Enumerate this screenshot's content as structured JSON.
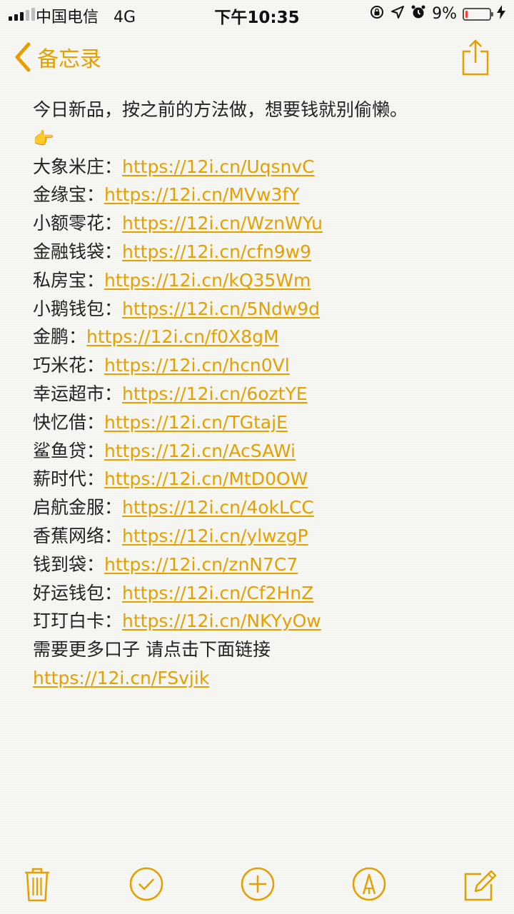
{
  "status_bar": {
    "carrier": "中国电信",
    "network": "4G",
    "time": "下午10:35",
    "battery": "9%",
    "battery_level": 0.09
  },
  "nav": {
    "back_label": "备忘录"
  },
  "note": {
    "intro": "今日新品，按之前的方法做，想要钱就别偷懒。",
    "pointer": "👉",
    "items": [
      {
        "name": "大象米庄：",
        "url": "https://12i.cn/UqsnvC"
      },
      {
        "name": "金缘宝：",
        "url": "https://12i.cn/MVw3fY"
      },
      {
        "name": "小额零花：",
        "url": "https://12i.cn/WznWYu"
      },
      {
        "name": "金融钱袋：",
        "url": "https://12i.cn/cfn9w9"
      },
      {
        "name": "私房宝：",
        "url": "https://12i.cn/kQ35Wm"
      },
      {
        "name": "小鹅钱包：",
        "url": "https://12i.cn/5Ndw9d"
      },
      {
        "name": "金鹏：",
        "url": "https://12i.cn/f0X8gM"
      },
      {
        "name": "巧米花：",
        "url": "https://12i.cn/hcn0Vl"
      },
      {
        "name": "幸运超市：",
        "url": "https://12i.cn/6oztYE"
      },
      {
        "name": "快忆借：",
        "url": "https://12i.cn/TGtajE"
      },
      {
        "name": "鲨鱼贷：",
        "url": "https://12i.cn/AcSAWi"
      },
      {
        "name": "薪时代：",
        "url": "https://12i.cn/MtD0OW"
      },
      {
        "name": "启航金服：",
        "url": "https://12i.cn/4okLCC"
      },
      {
        "name": "香蕉网络：",
        "url": "https://12i.cn/ylwzgP"
      },
      {
        "name": "钱到袋：",
        "url": "https://12i.cn/znN7C7"
      },
      {
        "name": "好运钱包：",
        "url": "https://12i.cn/Cf2HnZ"
      },
      {
        "name": "玎玎白卡：",
        "url": "https://12i.cn/NKYyOw"
      }
    ],
    "more_text": "需要更多口子 请点击下面链接",
    "more_url": "https://12i.cn/FSvjik"
  },
  "colors": {
    "accent": "#e5a000",
    "background": "#f6f6f3",
    "text": "#222222",
    "battery_low": "#ff3b30"
  },
  "icons": {
    "back": "chevron-left-icon",
    "share": "share-icon",
    "trash": "trash-icon",
    "checklist": "checkmark-circle-icon",
    "add": "plus-circle-icon",
    "sketch": "pen-tip-circle-icon",
    "compose": "compose-icon"
  }
}
